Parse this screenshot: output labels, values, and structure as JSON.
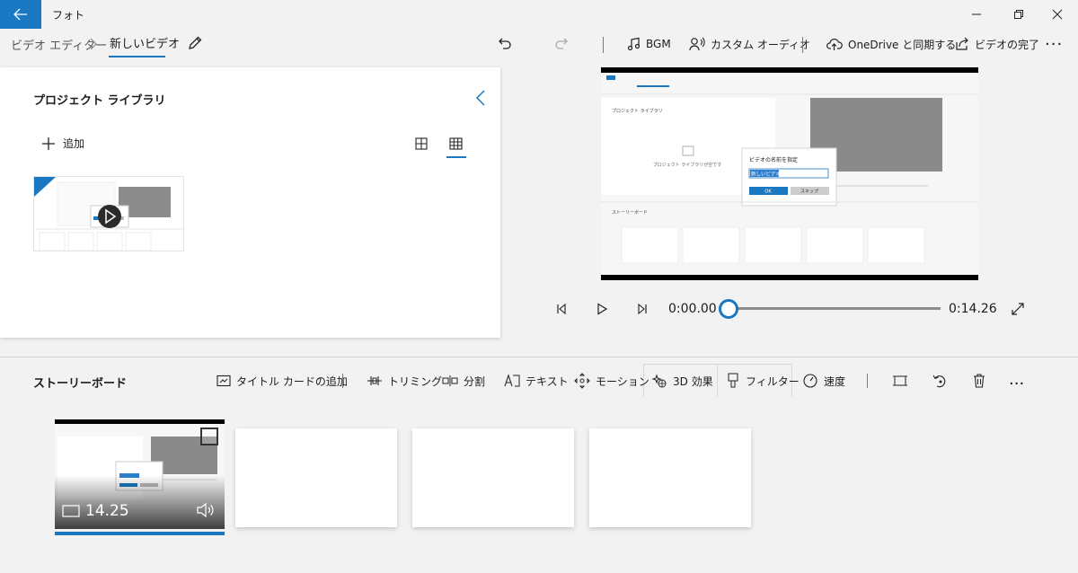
{
  "window": {
    "title": "フォト"
  },
  "breadcrumb": {
    "root": "ビデオ エディター",
    "current": "新しいビデオ"
  },
  "toolbar": {
    "bgm_label": "BGM",
    "custom_audio_label": "カスタム オーディオ",
    "onedrive_sync_label": "OneDrive と同期する",
    "finish_video_label": "ビデオの完了",
    "more_label": "..."
  },
  "library": {
    "title": "プロジェクト ライブラリ",
    "add_label": "追加"
  },
  "preview": {
    "dialog_title": "ビデオの名前を指定",
    "dialog_input": "新しいビデオ",
    "dialog_ok": "OK",
    "dialog_skip": "スキップ",
    "inner_library_title": "プロジェクト ライブラリ",
    "inner_empty_text": "プロジェクト ライブラリが空です",
    "inner_storyboard": "ストーリーボード"
  },
  "playback": {
    "current_time": "0:00.00",
    "total_time": "0:14.26",
    "progress": 0
  },
  "storyboard": {
    "title": "ストーリーボード",
    "add_title_card_label": "タイトル カードの追加",
    "trim_label": "トリミング",
    "split_label": "分割",
    "text_label": "テキスト",
    "motion_label": "モーション",
    "effects_3d_label": "3D 効果",
    "filter_label": "フィルター",
    "speed_label": "速度",
    "more_label": "...",
    "clips": [
      {
        "duration": "14.25"
      }
    ]
  },
  "colors": {
    "accent": "#1a78c2",
    "background": "#f2f2f2",
    "panel": "#ffffff"
  }
}
